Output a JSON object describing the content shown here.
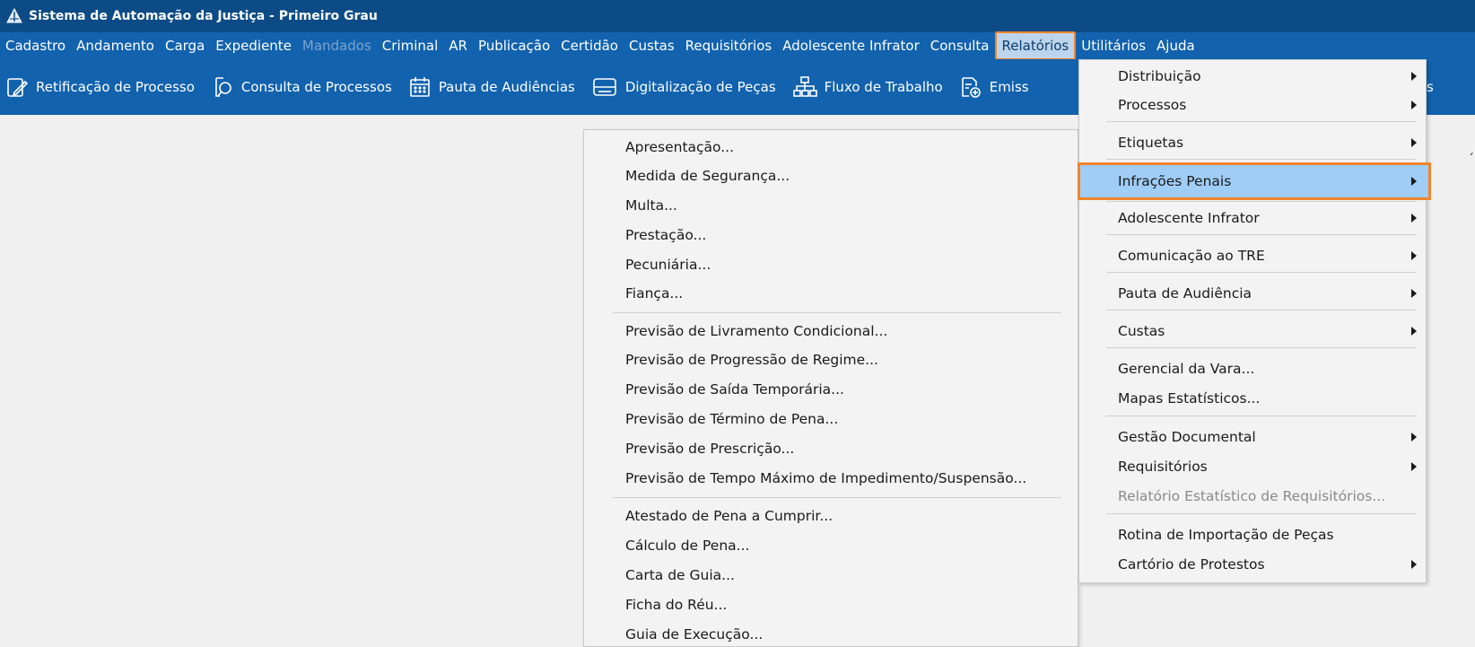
{
  "window": {
    "title": "Sistema de Automação da Justiça - Primeiro Grau"
  },
  "menubar": {
    "items": [
      {
        "label": "Cadastro"
      },
      {
        "label": "Andamento"
      },
      {
        "label": "Carga"
      },
      {
        "label": "Expediente"
      },
      {
        "label": "Mandados",
        "disabled": true
      },
      {
        "label": "Criminal"
      },
      {
        "label": "AR"
      },
      {
        "label": "Publicação"
      },
      {
        "label": "Certidão"
      },
      {
        "label": "Custas"
      },
      {
        "label": "Requisitórios"
      },
      {
        "label": "Adolescente Infrator"
      },
      {
        "label": "Consulta"
      },
      {
        "label": "Relatórios",
        "active": true
      },
      {
        "label": "Utilitários"
      },
      {
        "label": "Ajuda"
      }
    ]
  },
  "toolbar": {
    "items": [
      {
        "label": "Retificação de Processo",
        "icon": "edit-icon"
      },
      {
        "label": "Consulta de Processos",
        "icon": "search-document-icon"
      },
      {
        "label": "Pauta de Audiências",
        "icon": "calendar-icon"
      },
      {
        "label": "Digitalização de Peças",
        "icon": "scanner-icon"
      },
      {
        "label": "Fluxo de Trabalho",
        "icon": "workflow-icon"
      },
      {
        "label": "Emiss",
        "icon": "document-add-icon"
      }
    ],
    "overflow_text": "s"
  },
  "relatorios_menu": {
    "items": [
      {
        "label": "Distribuição",
        "submenu": true
      },
      {
        "label": "Processos",
        "submenu": true
      },
      {
        "label": "Etiquetas",
        "submenu": true
      },
      {
        "label": "Infrações Penais",
        "submenu": true,
        "highlighted": true
      },
      {
        "label": "Adolescente Infrator",
        "submenu": true
      },
      {
        "label": "Comunicação ao TRE",
        "submenu": true
      },
      {
        "label": "Pauta de Audiência",
        "submenu": true
      },
      {
        "label": "Custas",
        "submenu": true
      },
      {
        "label": "Gerencial da Vara..."
      },
      {
        "label": "Mapas Estatísticos..."
      },
      {
        "label": "Gestão Documental",
        "submenu": true
      },
      {
        "label": "Requisitórios",
        "submenu": true
      },
      {
        "label": "Relatório Estatístico de Requisitórios...",
        "disabled": true
      },
      {
        "label": "Rotina de Importação de Peças"
      },
      {
        "label": "Cartório de Protestos",
        "submenu": true
      }
    ]
  },
  "infracoes_submenu": {
    "items": [
      {
        "label": "Apresentação..."
      },
      {
        "label": "Medida de Segurança..."
      },
      {
        "label": "Multa..."
      },
      {
        "label": "Prestação..."
      },
      {
        "label": "Pecuniária..."
      },
      {
        "label": "Fiança..."
      },
      {
        "label": "Previsão de Livramento Condicional..."
      },
      {
        "label": "Previsão de Progressão de Regime..."
      },
      {
        "label": "Previsão de Saída Temporária..."
      },
      {
        "label": "Previsão de Término de Pena..."
      },
      {
        "label": "Previsão de Prescrição..."
      },
      {
        "label": "Previsão de Tempo Máximo de Impedimento/Suspensão..."
      },
      {
        "label": "Atestado de Pena a Cumprir..."
      },
      {
        "label": "Cálculo de Pena..."
      },
      {
        "label": "Carta de Guia..."
      },
      {
        "label": "Ficha do Réu..."
      },
      {
        "label": "Guia de Execução..."
      }
    ]
  },
  "colors": {
    "titlebar": "#0d4b86",
    "menubar": "#1262ae",
    "highlight_fill": "#9fcdf5",
    "highlight_border": "#f0852b",
    "disabled_text": "#8a8a8a"
  }
}
